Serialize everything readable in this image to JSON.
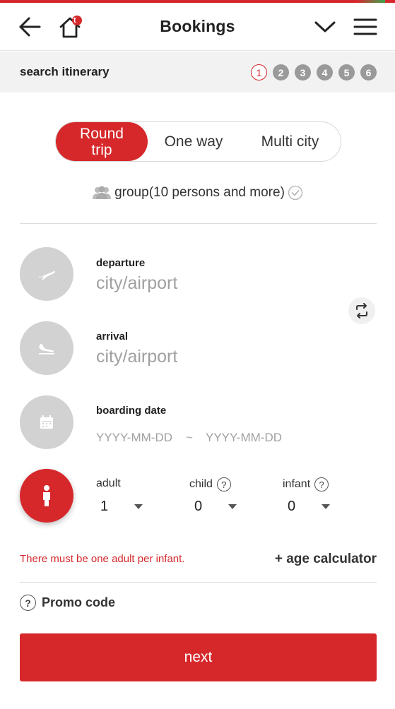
{
  "header": {
    "title": "Bookings",
    "back_icon": "back-arrow-icon",
    "home_icon": "home-icon",
    "home_badge": "t",
    "dropdown_icon": "chevron-down-icon",
    "menu_icon": "hamburger-menu-icon"
  },
  "steps": {
    "label": "search itinerary",
    "items": [
      "1",
      "2",
      "3",
      "4",
      "5",
      "6"
    ],
    "active": 1
  },
  "trip_type": {
    "tabs": [
      "Round trip",
      "One way",
      "Multi city"
    ],
    "selected": "Round trip"
  },
  "group": {
    "label": "group(10 persons and more)"
  },
  "departure": {
    "label": "departure",
    "placeholder": "city/airport"
  },
  "arrival": {
    "label": "arrival",
    "placeholder": "city/airport"
  },
  "boarding_date": {
    "label": "boarding date",
    "start_placeholder": "YYYY-MM-DD",
    "separator": "~",
    "end_placeholder": "YYYY-MM-DD"
  },
  "passengers": {
    "adult": {
      "label": "adult",
      "value": "1"
    },
    "child": {
      "label": "child",
      "value": "0",
      "help": "?"
    },
    "infant": {
      "label": "infant",
      "value": "0",
      "help": "?"
    }
  },
  "notice": {
    "warning": "There must be one adult per infant.",
    "age_calculator": "+ age calculator"
  },
  "promo": {
    "help": "?",
    "label": "Promo code"
  },
  "actions": {
    "next": "next"
  },
  "colors": {
    "accent": "#d6282b",
    "inactive": "#d2d2d2",
    "step_inactive": "#9a9a9a"
  }
}
